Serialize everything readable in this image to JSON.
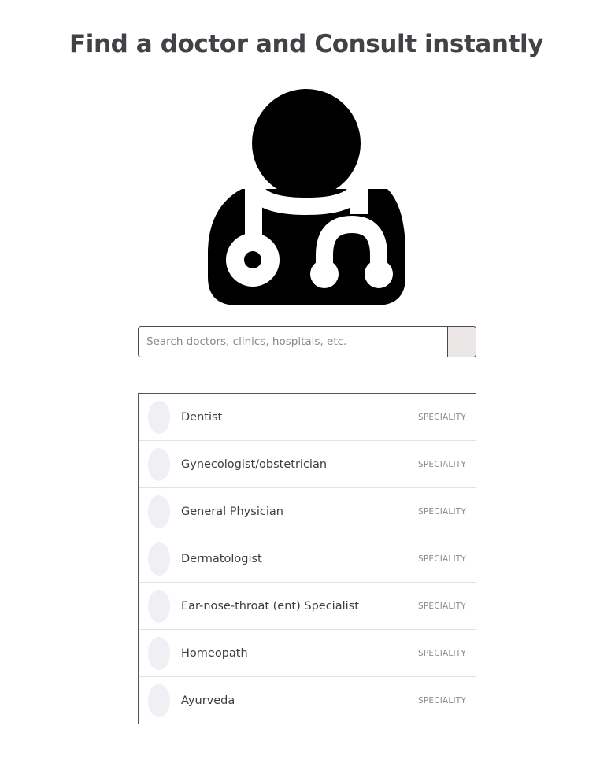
{
  "header": {
    "title": "Find a doctor and Consult instantly"
  },
  "hero": {
    "icon": "doctor-with-stethoscope-icon"
  },
  "search": {
    "placeholder": "Search doctors, clinics, hospitals, etc.",
    "value": ""
  },
  "results": {
    "items": [
      {
        "name": "Dentist",
        "type": "SPECIALITY"
      },
      {
        "name": "Gynecologist/obstetrician",
        "type": "SPECIALITY"
      },
      {
        "name": "General Physician",
        "type": "SPECIALITY"
      },
      {
        "name": "Dermatologist",
        "type": "SPECIALITY"
      },
      {
        "name": "Ear-nose-throat (ent) Specialist",
        "type": "SPECIALITY"
      },
      {
        "name": "Homeopath",
        "type": "SPECIALITY"
      },
      {
        "name": "Ayurveda",
        "type": "SPECIALITY"
      }
    ]
  },
  "colors": {
    "title": "#414146",
    "avatar": "#efeff4",
    "search_button": "#ebe7e7",
    "icon": "#000000"
  }
}
